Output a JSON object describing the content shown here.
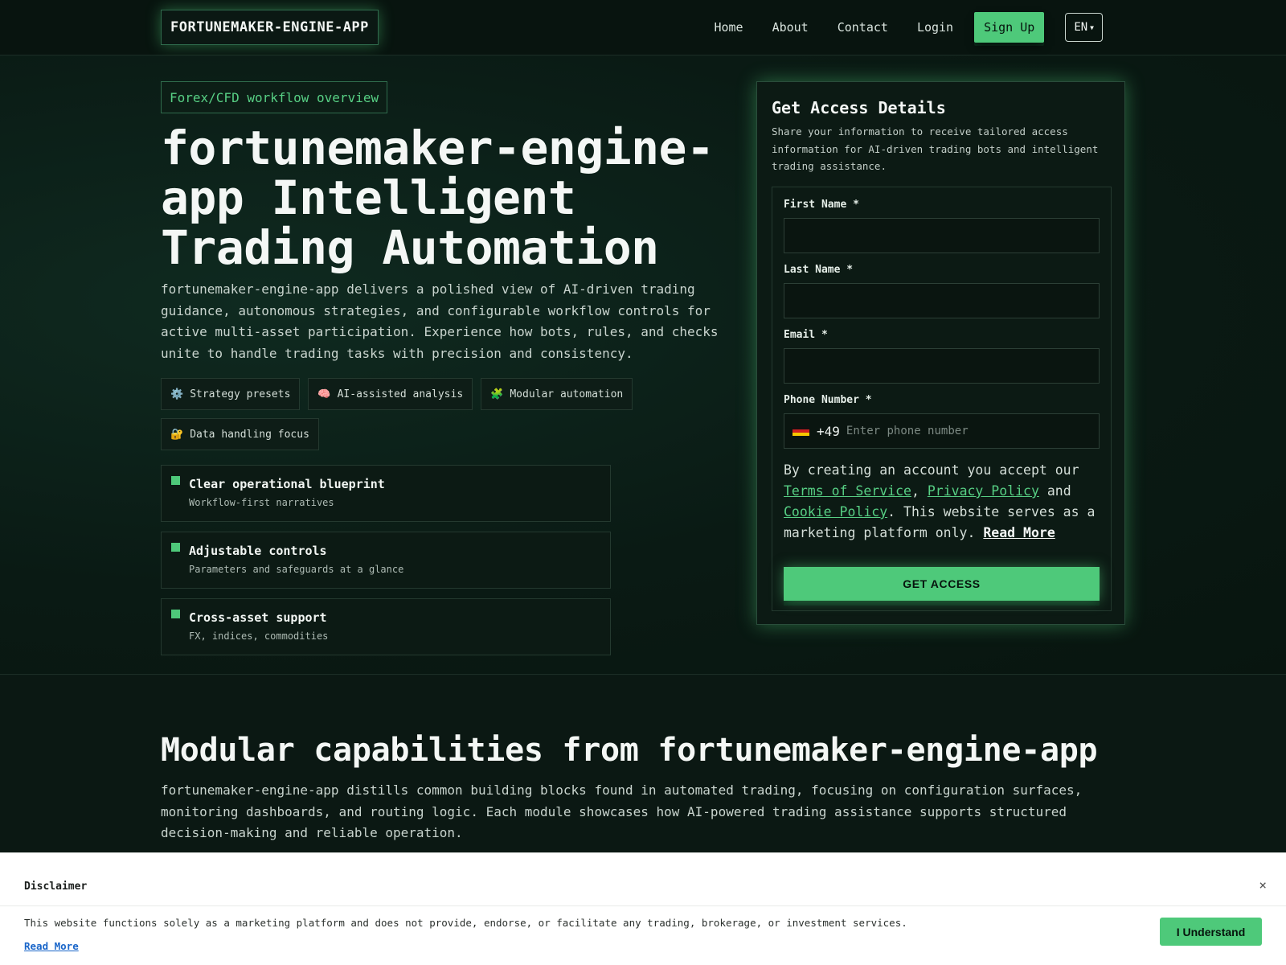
{
  "nav": {
    "logo": "FORTUNEMAKER-ENGINE-APP",
    "links": [
      "Home",
      "About",
      "Contact",
      "Login"
    ],
    "signup": "Sign Up",
    "lang": "EN"
  },
  "hero": {
    "badge": "Forex/CFD workflow overview",
    "title": "fortunemaker-engine-app Intelligent Trading Automation",
    "description": "fortunemaker-engine-app delivers a polished view of AI-driven trading guidance, autonomous strategies, and configurable workflow controls for active multi-asset participation. Experience how bots, rules, and checks unite to handle trading tasks with precision and consistency.",
    "chips": [
      {
        "icon": "⚙️",
        "icon_name": "gear-icon",
        "label": "Strategy presets"
      },
      {
        "icon": "🧠",
        "icon_name": "brain-icon",
        "label": "AI-assisted analysis"
      },
      {
        "icon": "🧩",
        "icon_name": "puzzle-icon",
        "label": "Modular automation"
      },
      {
        "icon": "🔐",
        "icon_name": "lock-icon",
        "label": "Data handling focus"
      }
    ],
    "features": [
      {
        "title": "Clear operational blueprint",
        "subtitle": "Workflow-first narratives"
      },
      {
        "title": "Adjustable controls",
        "subtitle": "Parameters and safeguards at a glance"
      },
      {
        "title": "Cross-asset support",
        "subtitle": "FX, indices, commodities"
      }
    ]
  },
  "form": {
    "title": "Get Access Details",
    "subtitle": "Share your information to receive tailored access information for AI-driven trading bots and intelligent trading assistance.",
    "first_name_label": "First Name *",
    "last_name_label": "Last Name *",
    "email_label": "Email *",
    "phone_label": "Phone Number *",
    "phone_dial": "+49",
    "phone_placeholder": "Enter phone number",
    "phone_flag": "de-flag-icon",
    "legal_prefix": "By creating an account you accept our ",
    "terms": "Terms of Service",
    "comma": ", ",
    "privacy": "Privacy Policy",
    "and": " and ",
    "cookie": "Cookie Policy",
    "legal_suffix": ". This website serves as a marketing platform only. ",
    "read_more": "Read More",
    "cta": "GET ACCESS"
  },
  "section2": {
    "title": "Modular capabilities from fortunemaker-engine-app",
    "description": "fortunemaker-engine-app distills common building blocks found in automated trading, focusing on configuration surfaces, monitoring dashboards, and routing logic. Each module showcases how AI-powered trading assistance supports structured decision-making and reliable operation."
  },
  "disclaimer": {
    "title": "Disclaimer",
    "close": "×",
    "text": "This website functions solely as a marketing platform and does not provide, endorse, or facilitate any trading, brokerage, or investment services.",
    "read_more": "Read More",
    "button": "I Understand"
  },
  "colors": {
    "accent": "#4ec97a",
    "background": "#0b1a15",
    "link": "#1a66c9"
  }
}
